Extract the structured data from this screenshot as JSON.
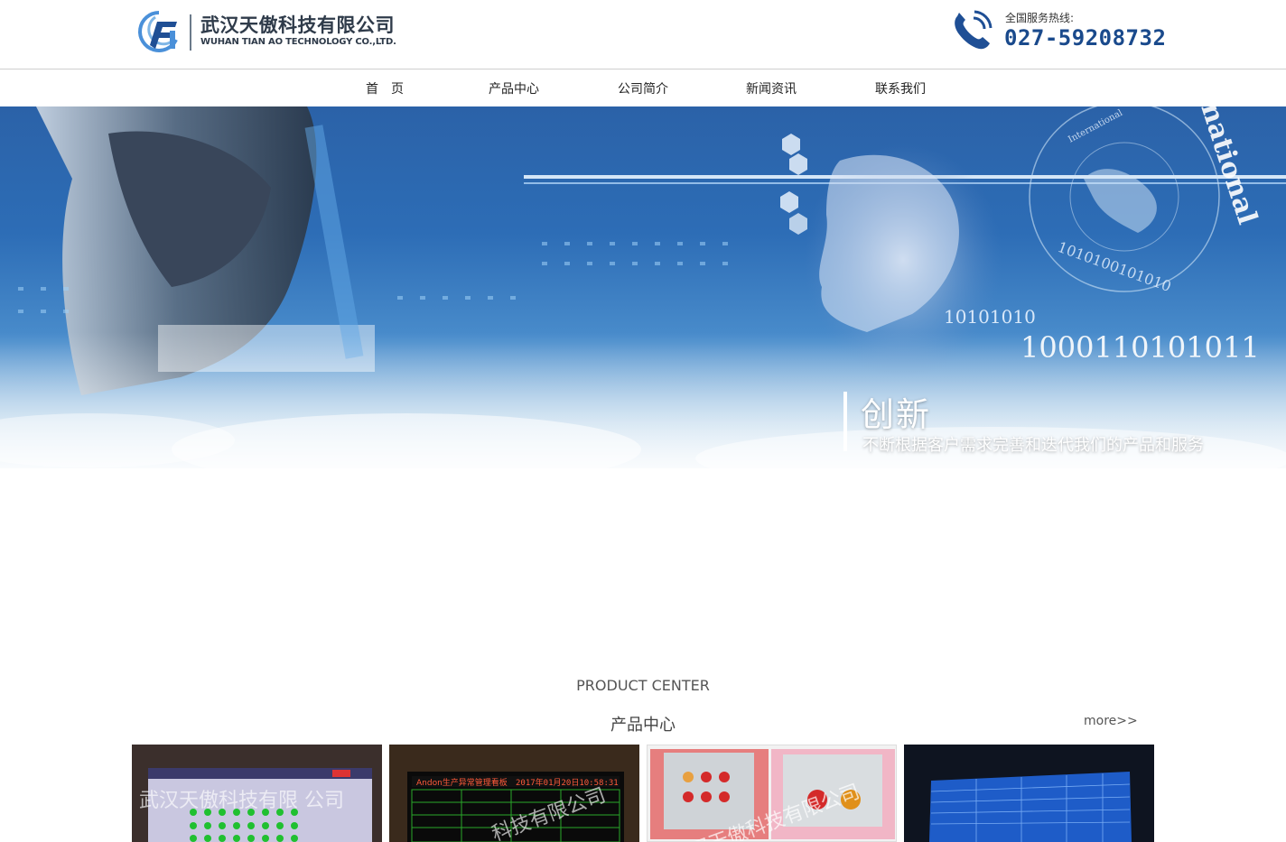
{
  "header": {
    "company_name_cn": "武汉天傲科技有限公司",
    "company_name_en": "WUHAN TIAN AO TECHNOLOGY CO.,LTD.",
    "hotline_label": "全国服务热线:",
    "hotline_number": "027-59208732"
  },
  "nav": {
    "items": [
      {
        "label": "首　页"
      },
      {
        "label": "产品中心"
      },
      {
        "label": "公司简介"
      },
      {
        "label": "新闻资讯"
      },
      {
        "label": "联系我们"
      }
    ]
  },
  "banner": {
    "title": "创新",
    "subtitle": "不断根据客户需求完善和迭代我们的产品和服务",
    "binary_1": "10101010",
    "binary_2": "1000110101011",
    "binary_3": "1010100101010",
    "ring_text": "International",
    "ring_text_2": "national"
  },
  "product_center": {
    "title_en": "PRODUCT CENTER",
    "title_cn": "产品中心",
    "more_label": "more>>",
    "watermark_1": "武汉天傲科技有限 公司",
    "watermark_2": "科技有限公司",
    "watermark_3": "武汉天傲科技有限公司",
    "board_title_2": "Andon生产异常管理看板",
    "board_date_2": "2017年01月20日10:58:31"
  },
  "colors": {
    "brand_blue": "#1a4a8c",
    "banner_blue": "#2d6db6"
  }
}
